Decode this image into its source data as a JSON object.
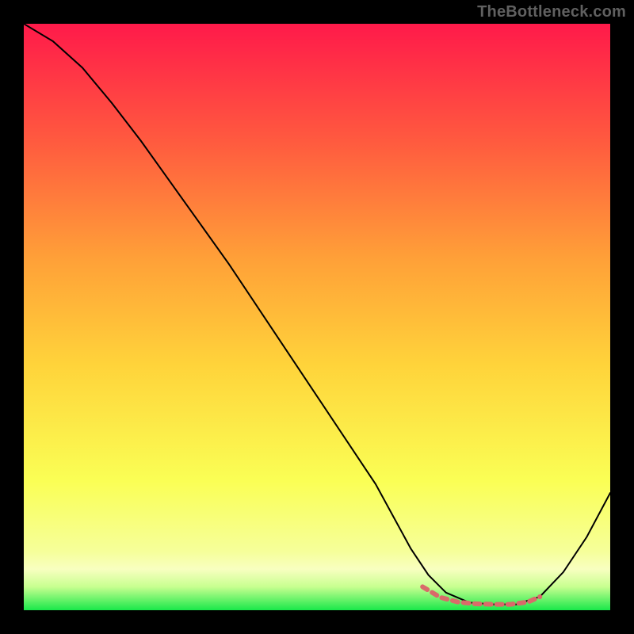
{
  "watermark": "TheBottleneck.com",
  "chart_data": {
    "type": "line",
    "title": "",
    "xlabel": "",
    "ylabel": "",
    "xlim": [
      0,
      100
    ],
    "ylim": [
      0,
      100
    ],
    "gradient_colors": {
      "top": "#ff1a4a",
      "upper_mid": "#ff8a3a",
      "mid": "#ffd33a",
      "lower_mid": "#f7ff6a",
      "band": "#f8ffb0",
      "bottom": "#19e84a"
    },
    "series": [
      {
        "name": "curve",
        "color": "#000000",
        "stroke_width": 2,
        "x": [
          0,
          5,
          10,
          15,
          20,
          25,
          30,
          35,
          40,
          45,
          50,
          55,
          60,
          63,
          66,
          69,
          72,
          76,
          80,
          84,
          88,
          92,
          96,
          100
        ],
        "y": [
          100,
          97,
          92.5,
          86.5,
          80,
          73,
          66,
          59,
          51.5,
          44,
          36.5,
          29,
          21.5,
          16,
          10.5,
          6,
          3,
          1.3,
          1.0,
          1.0,
          2.3,
          6.5,
          12.5,
          20
        ]
      },
      {
        "name": "dash-segment",
        "color": "#d96a6a",
        "stroke_width": 6,
        "dash": "7 7",
        "x": [
          68,
          71,
          74,
          77,
          80,
          83,
          86,
          88
        ],
        "y": [
          4,
          2.2,
          1.4,
          1.1,
          1.0,
          1.0,
          1.4,
          2.3
        ]
      }
    ],
    "annotations": []
  }
}
